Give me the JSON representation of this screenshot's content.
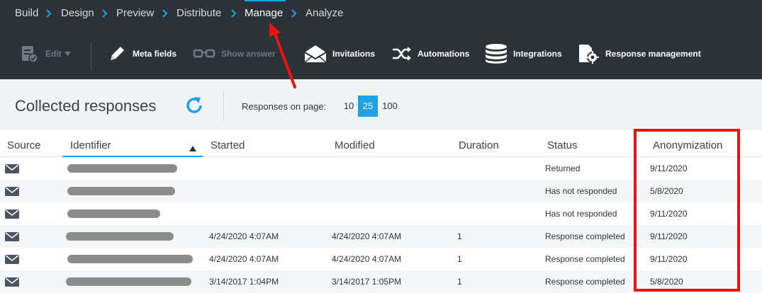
{
  "nav": {
    "items": [
      {
        "label": "Build"
      },
      {
        "label": "Design"
      },
      {
        "label": "Preview"
      },
      {
        "label": "Distribute"
      },
      {
        "label": "Manage",
        "active": true
      },
      {
        "label": "Analyze"
      }
    ]
  },
  "toolbar": {
    "edit": "Edit",
    "meta_fields": "Meta fields",
    "show_answer": "Show answer",
    "invitations": "Invitations",
    "automations": "Automations",
    "integrations": "Integrations",
    "response_management": "Response management"
  },
  "page": {
    "title": "Collected responses",
    "per_page_label": "Responses on page:",
    "per_page_options": [
      "10",
      "25",
      "100"
    ],
    "per_page_selected": "25"
  },
  "table": {
    "columns": [
      "Source",
      "Identifier",
      "Started",
      "Modified",
      "Duration",
      "Status",
      "Anonymization"
    ],
    "sorted_column": "Identifier",
    "rows": [
      {
        "source": "mail-icon",
        "started": "",
        "modified": "",
        "duration": "",
        "status": "Returned",
        "anonymization": "9/11/2020"
      },
      {
        "source": "mail-icon",
        "started": "",
        "modified": "",
        "duration": "",
        "status": "Has not responded",
        "anonymization": "5/8/2020"
      },
      {
        "source": "mail-icon",
        "started": "",
        "modified": "",
        "duration": "",
        "status": "Has not responded",
        "anonymization": "9/11/2020"
      },
      {
        "source": "mail-icon",
        "started": "4/24/2020 4:07AM",
        "modified": "4/24/2020 4:07AM",
        "duration": "1",
        "status": "Response completed",
        "anonymization": "9/11/2020"
      },
      {
        "source": "mail-icon",
        "started": "4/24/2020 4:07AM",
        "modified": "4/24/2020 4:07AM",
        "duration": "1",
        "status": "Response completed",
        "anonymization": "9/11/2020"
      },
      {
        "source": "mail-icon",
        "started": "3/14/2017 1:04PM",
        "modified": "3/14/2017 1:05PM",
        "duration": "1",
        "status": "Response completed",
        "anonymization": "5/8/2020"
      }
    ]
  },
  "colors": {
    "nav_bg": "#2b3238",
    "accent": "#1aa3e8",
    "annotation_red": "#ee1111"
  }
}
